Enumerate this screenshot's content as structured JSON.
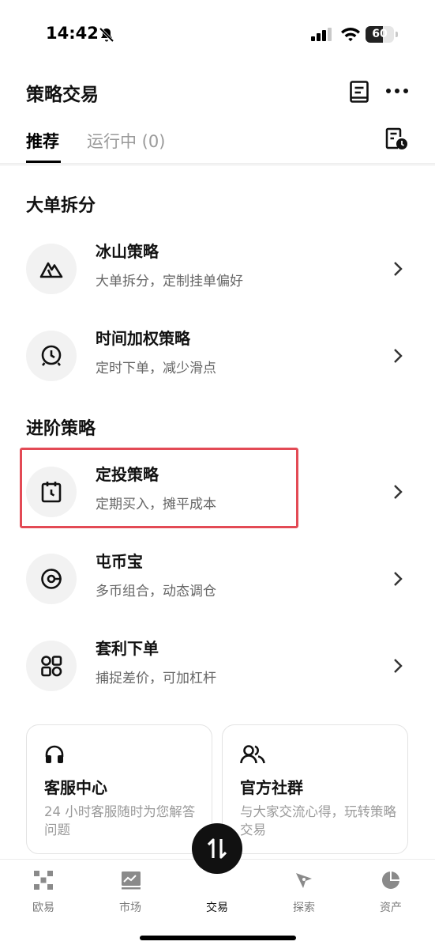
{
  "status_bar": {
    "time": "14:42",
    "battery_level": "60",
    "battery_fraction": 0.6,
    "icons": [
      "bell-slash-icon",
      "cellular-signal-icon",
      "wifi-icon",
      "battery-icon"
    ]
  },
  "header": {
    "title": "策略交易",
    "icons": [
      "document-icon",
      "more-icon"
    ]
  },
  "tabs": [
    {
      "label": "推荐",
      "active": true
    },
    {
      "label": "运行中 (0)",
      "active": false
    }
  ],
  "sections": {
    "large_order": {
      "title": "大单拆分",
      "items": [
        {
          "name": "冰山策略",
          "desc": "大单拆分，定制挂单偏好",
          "icon": "iceberg-icon"
        },
        {
          "name": "时间加权策略",
          "desc": "定时下单，减少滑点",
          "icon": "clock-icon"
        }
      ]
    },
    "advanced": {
      "title": "进阶策略",
      "items": [
        {
          "name": "定投策略",
          "desc": "定期买入，摊平成本",
          "icon": "calendar-clock-icon",
          "highlighted": true
        },
        {
          "name": "屯币宝",
          "desc": "多币组合，动态调仓",
          "icon": "coin-pie-icon"
        },
        {
          "name": "套利下单",
          "desc": "捕捉差价，可加杠杆",
          "icon": "arbitrage-icon"
        }
      ]
    }
  },
  "support_cards": [
    {
      "title": "客服中心",
      "desc": "24 小时客服随时为您解答问题",
      "icon": "headset-icon"
    },
    {
      "title": "官方社群",
      "desc": "与大家交流心得，玩转策略交易",
      "icon": "community-icon"
    }
  ],
  "bottom_nav": {
    "items": [
      {
        "label": "欧易",
        "icon": "okx-logo-icon"
      },
      {
        "label": "市场",
        "icon": "market-chart-icon"
      },
      {
        "label": "交易",
        "icon": "trade-swap-icon",
        "active": true
      },
      {
        "label": "探索",
        "icon": "compass-icon"
      },
      {
        "label": "资产",
        "icon": "pie-chart-icon"
      }
    ]
  },
  "colors": {
    "highlight_border": "#e34a55",
    "text_primary": "#111111",
    "text_secondary": "#666666",
    "text_muted": "#9a9a9a",
    "icon_bg": "#f2f2f2"
  }
}
